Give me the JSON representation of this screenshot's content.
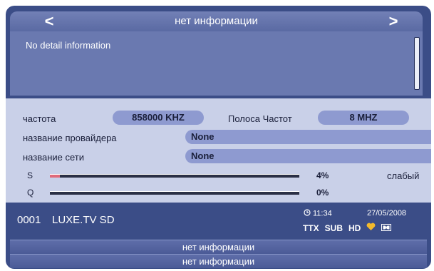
{
  "header": {
    "title": "нет информации",
    "prev_arrow": "<",
    "next_arrow": ">"
  },
  "details": {
    "text": "No detail information"
  },
  "info": {
    "frequency_label": "частота",
    "frequency_value": "858000 KHZ",
    "bandwidth_label": "Полоса Частот",
    "bandwidth_value": "8 MHZ",
    "provider_label": "название провайдера",
    "provider_value": "None",
    "network_label": "название сети",
    "network_value": "None"
  },
  "signal": {
    "strength_label": "S",
    "strength_percent": "4%",
    "strength_level": 0.04,
    "quality_word": "слабый",
    "quality_label": "Q",
    "quality_percent": "0%",
    "quality_level": 0.0
  },
  "channel": {
    "number": "0001",
    "name": "LUXE.TV SD",
    "time": "11:34",
    "date": "27/05/2008",
    "badges": [
      "TTX",
      "SUB",
      "HD"
    ]
  },
  "epg": {
    "now": "нет информации",
    "next": "нет информации"
  },
  "colors": {
    "panel": "#3b4d87",
    "background": "#c9d0e8",
    "value_field": "#8e9ad0",
    "signal_fill": "#e06a7a",
    "heart": "#f2b92c"
  }
}
